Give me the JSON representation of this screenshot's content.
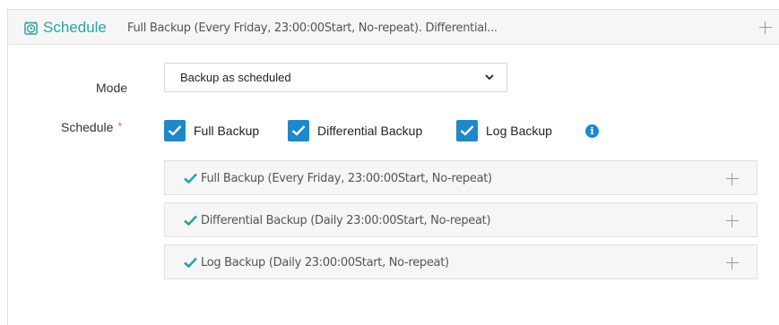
{
  "header": {
    "title": "Schedule",
    "summary": "Full Backup (Every Friday, 23:00:00Start, No-repeat). Differential..."
  },
  "mode": {
    "label": "Mode",
    "value": "Backup as scheduled"
  },
  "schedule": {
    "label": "Schedule",
    "required_mark": "*",
    "options": [
      {
        "label": "Full Backup",
        "checked": true
      },
      {
        "label": "Differential Backup",
        "checked": true
      },
      {
        "label": "Log Backup",
        "checked": true
      }
    ],
    "info_icon": "i"
  },
  "entries": [
    {
      "text": "Full Backup (Every Friday, 23:00:00Start, No-repeat)"
    },
    {
      "text": "Differential Backup (Daily 23:00:00Start, No-repeat)"
    },
    {
      "text": "Log Backup (Daily 23:00:00Start, No-repeat)"
    }
  ],
  "colors": {
    "accent": "#2aa3a3",
    "checkbox": "#1e88c8",
    "required": "#e25b5b"
  },
  "icons": {
    "header": "alarm-clock-icon",
    "expand": "plus-icon",
    "dropdown": "chevron-down-icon",
    "info": "info-icon",
    "entry": "checkmark-icon"
  }
}
